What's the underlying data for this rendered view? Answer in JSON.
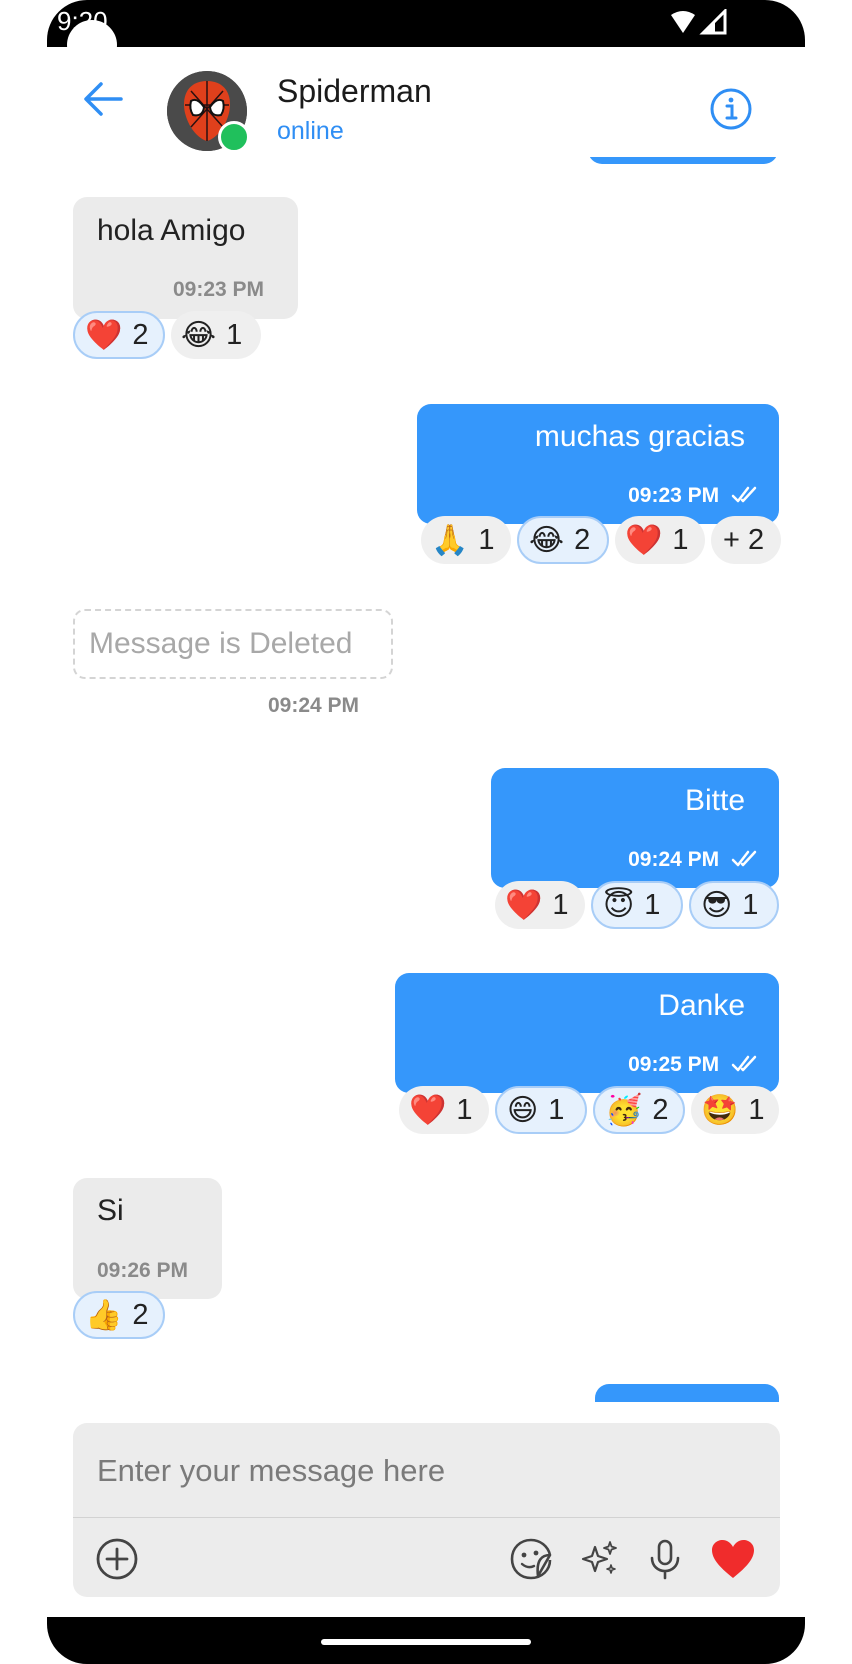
{
  "status_bar": {
    "time": "9:20"
  },
  "header": {
    "name": "Spiderman",
    "presence": "online"
  },
  "messages": [
    {
      "direction": "in",
      "text": "hola Amigo",
      "time": "09:23 PM",
      "reactions": [
        {
          "emoji": "❤️",
          "count": "2",
          "selected": true
        },
        {
          "emoji": "😂",
          "count": "1",
          "selected": false
        }
      ]
    },
    {
      "direction": "out",
      "text": "muchas gracias",
      "time": "09:23 PM",
      "reactions": [
        {
          "emoji": "🙏",
          "count": "1",
          "selected": false
        },
        {
          "emoji": "😂",
          "count": "2",
          "selected": true
        },
        {
          "emoji": "❤️",
          "count": "1",
          "selected": false
        },
        {
          "emoji": "",
          "count": "+ 2",
          "selected": false
        }
      ]
    },
    {
      "direction": "in",
      "deleted": true,
      "text": "Message is Deleted",
      "time": "09:24 PM"
    },
    {
      "direction": "out",
      "text": "Bitte",
      "time": "09:24 PM",
      "reactions": [
        {
          "emoji": "❤️",
          "count": "1",
          "selected": false
        },
        {
          "emoji": "😇",
          "count": "1",
          "selected": true
        },
        {
          "emoji": "😎",
          "count": "1",
          "selected": true
        }
      ]
    },
    {
      "direction": "out",
      "text": "Danke",
      "time": "09:25 PM",
      "reactions": [
        {
          "emoji": "❤️",
          "count": "1",
          "selected": false
        },
        {
          "emoji": "😄",
          "count": "1",
          "selected": true
        },
        {
          "emoji": "🥳",
          "count": "2",
          "selected": true
        },
        {
          "emoji": "🤩",
          "count": "1",
          "selected": false
        }
      ]
    },
    {
      "direction": "in",
      "text": "Si",
      "time": "09:26 PM",
      "reactions": [
        {
          "emoji": "👍",
          "count": "2",
          "selected": true
        }
      ]
    }
  ],
  "composer": {
    "placeholder": "Enter your message here",
    "icons": [
      "add-circle-icon",
      "sticker-icon",
      "sparkles-icon",
      "microphone-icon",
      "heart-icon"
    ]
  },
  "colors": {
    "accent": "#3597fb",
    "incoming": "#ebebeb",
    "online": "#20c05c",
    "heart": "#f02c2c"
  }
}
